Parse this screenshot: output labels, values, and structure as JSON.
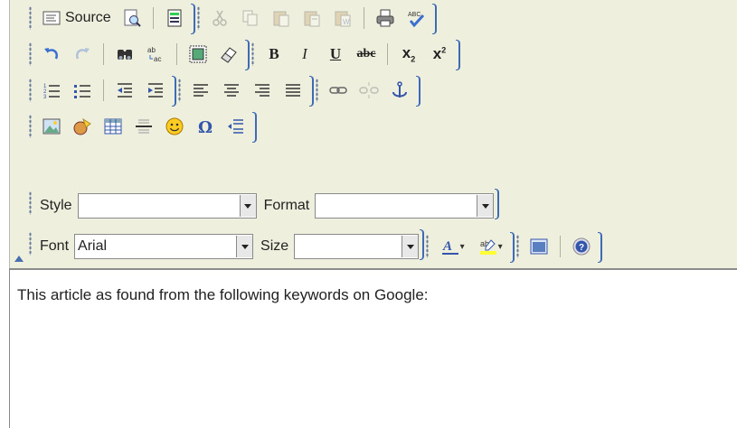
{
  "toolbar": {
    "row1": {
      "source_label": "Source"
    },
    "row3": {},
    "row5": {
      "style_label": "Style",
      "style_value": "",
      "format_label": "Format",
      "format_value": ""
    },
    "row6": {
      "font_label": "Font",
      "font_value": "Arial",
      "size_label": "Size",
      "size_value": ""
    },
    "text_buttons": {
      "bold": "B",
      "italic": "I",
      "underline": "U",
      "strike": "abc",
      "subscript_base": "x",
      "superscript_base": "x"
    }
  },
  "content": {
    "text": "This article as found from the following keywords on Google:"
  },
  "colors": {
    "toolbar_bg": "#efefde",
    "group_border": "#3d6bb5"
  }
}
